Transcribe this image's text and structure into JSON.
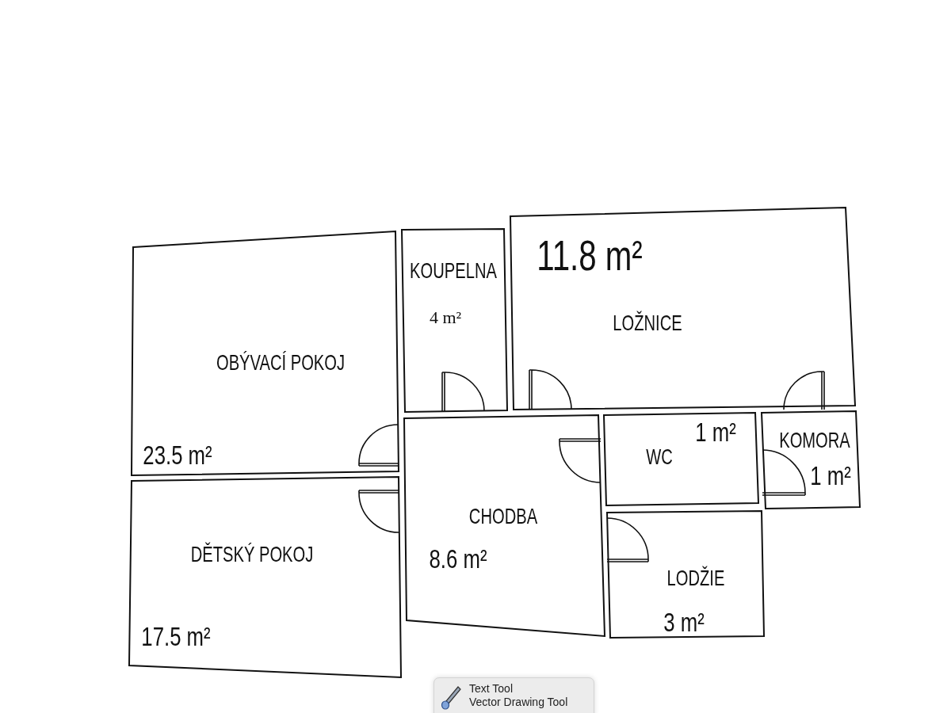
{
  "plan": {
    "rooms": [
      {
        "name": "OBÝVACÍ POKOJ",
        "area": "23.5 m²"
      },
      {
        "name": "KOUPELNA",
        "area": "4 m²"
      },
      {
        "name": "LOŽNICE",
        "area": "11.8 m²"
      },
      {
        "name": "CHODBA",
        "area": "8.6 m²"
      },
      {
        "name": "WC",
        "area": "1 m²"
      },
      {
        "name": "KOMORA",
        "area": "1 m²"
      },
      {
        "name": "DĚTSKÝ POKOJ",
        "area": "17.5 m²"
      },
      {
        "name": "LODŽIE",
        "area": "3 m²"
      }
    ]
  },
  "tool_popup": {
    "items": [
      {
        "label": "Text Tool"
      },
      {
        "label": "Vector Drawing Tool"
      }
    ]
  }
}
